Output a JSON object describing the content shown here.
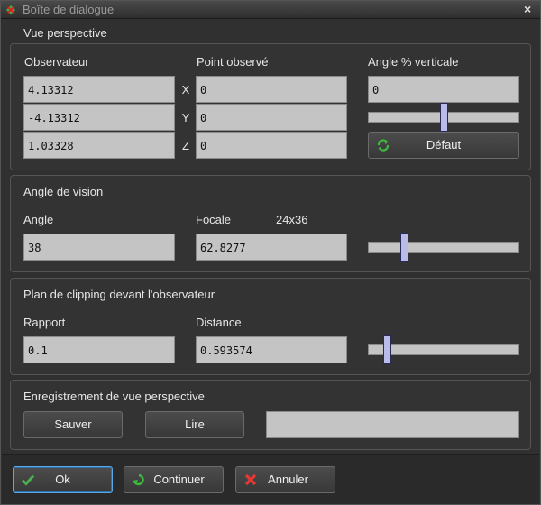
{
  "window": {
    "title": "Boîte de dialogue",
    "close_glyph": "×"
  },
  "perspective": {
    "title": "Vue perspective",
    "observer_label": "Observateur",
    "point_label": "Point observé",
    "angle_label": "Angle % verticale",
    "observer": [
      "4.13312",
      "-4.13312",
      "1.03328"
    ],
    "point": [
      "0",
      "0",
      "0"
    ],
    "axes": [
      "X",
      "Y",
      "Z"
    ],
    "angle_value": "0",
    "angle_slider_fraction": 0.5,
    "default_button": "Défaut"
  },
  "vision": {
    "title": "Angle de vision",
    "angle_label": "Angle",
    "focal_label": "Focale",
    "format_label": "24x36",
    "angle_value": "38",
    "focal_value": "62.8277",
    "slider_fraction": 0.22
  },
  "clipping": {
    "title": "Plan de clipping devant l'observateur",
    "ratio_label": "Rapport",
    "distance_label": "Distance",
    "ratio_value": "0.1",
    "distance_value": "0.593574",
    "slider_fraction": 0.1
  },
  "record": {
    "title": "Enregistrement de vue perspective",
    "save_button": "Sauver",
    "read_button": "Lire",
    "name_value": ""
  },
  "footer": {
    "ok_button": "Ok",
    "continue_button": "Continuer",
    "cancel_button": "Annuler"
  },
  "colors": {
    "accent": "#5aa8e8",
    "ok_check": "#4caf50",
    "cancel_x": "#e53935",
    "refresh": "#3dbb3d"
  }
}
